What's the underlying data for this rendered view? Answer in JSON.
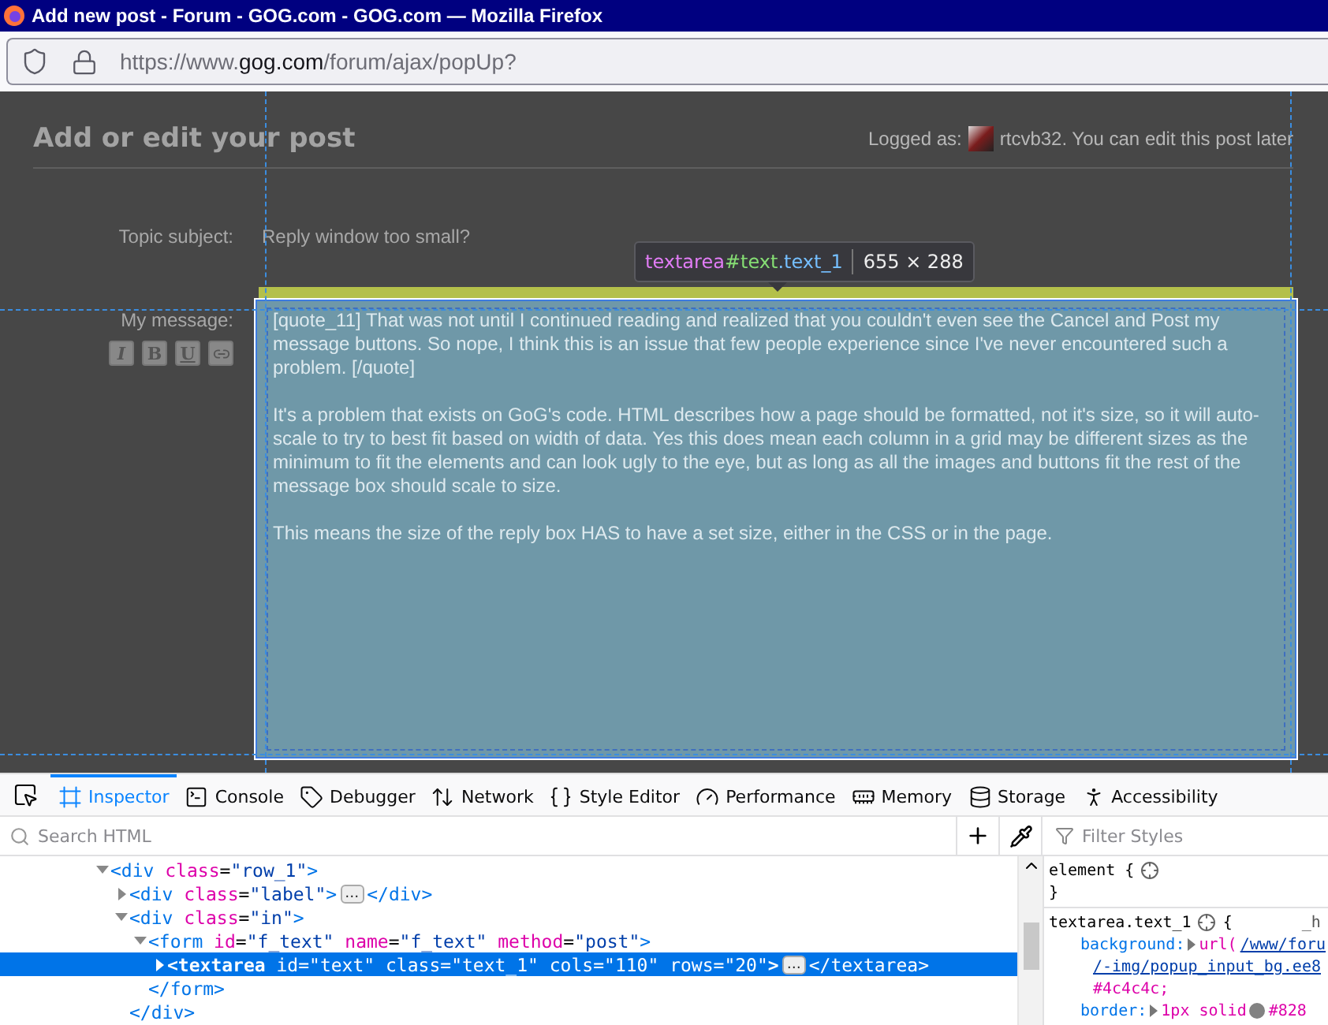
{
  "window": {
    "title": "Add new post - Forum - GOG.com - GOG.com — Mozilla Firefox"
  },
  "address_bar": {
    "url_prefix": "https://www.",
    "url_domain": "gog.com",
    "url_path": "/forum/ajax/popUp?"
  },
  "page": {
    "heading": "Add or edit your post",
    "logged_as": "Logged as:",
    "user_note": "rtcvb32. You can edit this post later",
    "topic_label": "Topic subject:",
    "topic_value": "Reply window too small?",
    "message_label": "My message:",
    "format_buttons": [
      {
        "kind": "italic",
        "label": "I"
      },
      {
        "kind": "bold",
        "label": "B"
      },
      {
        "kind": "underline",
        "label": "U"
      },
      {
        "kind": "link"
      }
    ],
    "message_paragraphs": [
      "[quote_11] That was not until I continued reading and realized that you couldn't even see the Cancel and Post my message buttons. So nope, I think this is an issue that few people experience since I've never encountered such a problem.  [/quote]",
      "It's a problem that exists on GoG's code. HTML describes how a page should be formatted, not it's size, so it will auto-scale to try to best fit based on width of data. Yes this does mean each column in a grid may be different sizes as the minimum to fit the elements and can look ugly to the eye, but as long as all the images and buttons fit the rest of the message box should scale to size.",
      "This means the size of the reply box HAS to have a set size, either in the CSS or in the page."
    ],
    "tooltip": {
      "tag": "textarea",
      "id": "#text",
      "cls": ".text_1",
      "size": "655 × 288"
    }
  },
  "devtools": {
    "tabs": [
      {
        "kind": "inspector",
        "label": "Inspector",
        "selected": true
      },
      {
        "kind": "console",
        "label": "Console",
        "selected": false
      },
      {
        "kind": "debugger",
        "label": "Debugger",
        "selected": false
      },
      {
        "kind": "network",
        "label": "Network",
        "selected": false
      },
      {
        "kind": "style",
        "label": "Style Editor",
        "selected": false
      },
      {
        "kind": "performance",
        "label": "Performance",
        "selected": false
      },
      {
        "kind": "memory",
        "label": "Memory",
        "selected": false
      },
      {
        "kind": "storage",
        "label": "Storage",
        "selected": false
      },
      {
        "kind": "accessibility",
        "label": "Accessibility",
        "selected": false
      }
    ],
    "search_placeholder": "Search HTML",
    "filter_placeholder": "Filter Styles",
    "markup": [
      {
        "expanded": true,
        "selected": false,
        "tokens": [
          {
            "kind": "tag",
            "t": "<div"
          },
          {
            "kind": "attr",
            "t": " class"
          },
          {
            "kind": "punct",
            "t": "="
          },
          {
            "kind": "val",
            "t": "\"row_1\""
          },
          {
            "kind": "tag",
            "t": ">"
          }
        ],
        "children": [
          {
            "expanded": false,
            "selected": false,
            "tokens": [
              {
                "kind": "tag",
                "t": "<div"
              },
              {
                "kind": "attr",
                "t": " class"
              },
              {
                "kind": "punct",
                "t": "="
              },
              {
                "kind": "val",
                "t": "\"label\""
              },
              {
                "kind": "tag",
                "t": ">"
              }
            ],
            "badge": "…",
            "close": "</div>"
          },
          {
            "expanded": true,
            "selected": false,
            "tokens": [
              {
                "kind": "tag",
                "t": "<div"
              },
              {
                "kind": "attr",
                "t": " class"
              },
              {
                "kind": "punct",
                "t": "="
              },
              {
                "kind": "val",
                "t": "\"in\""
              },
              {
                "kind": "tag",
                "t": ">"
              }
            ],
            "end": "</div>",
            "children": [
              {
                "expanded": true,
                "selected": false,
                "tokens": [
                  {
                    "kind": "tag",
                    "t": "<form"
                  },
                  {
                    "kind": "attr",
                    "t": " id"
                  },
                  {
                    "kind": "punct",
                    "t": "="
                  },
                  {
                    "kind": "val",
                    "t": "\"f_text\""
                  },
                  {
                    "kind": "attr",
                    "t": " name"
                  },
                  {
                    "kind": "punct",
                    "t": "="
                  },
                  {
                    "kind": "val",
                    "t": "\"f_text\""
                  },
                  {
                    "kind": "attr",
                    "t": " method"
                  },
                  {
                    "kind": "punct",
                    "t": "="
                  },
                  {
                    "kind": "val",
                    "t": "\"post\""
                  },
                  {
                    "kind": "tag",
                    "t": ">"
                  }
                ],
                "end": "</form>",
                "children": [
                  {
                    "expanded": false,
                    "selected": true,
                    "tokens": [
                      {
                        "kind": "tag",
                        "t": "<textarea"
                      },
                      {
                        "kind": "attr",
                        "t": " id"
                      },
                      {
                        "kind": "punct",
                        "t": "="
                      },
                      {
                        "kind": "val",
                        "t": "\"text\""
                      },
                      {
                        "kind": "attr",
                        "t": " class"
                      },
                      {
                        "kind": "punct",
                        "t": "="
                      },
                      {
                        "kind": "val",
                        "t": "\"text_1\""
                      },
                      {
                        "kind": "attr",
                        "t": " cols"
                      },
                      {
                        "kind": "punct",
                        "t": "="
                      },
                      {
                        "kind": "val",
                        "t": "\"110\""
                      },
                      {
                        "kind": "attr",
                        "t": " rows"
                      },
                      {
                        "kind": "punct",
                        "t": "="
                      },
                      {
                        "kind": "val",
                        "t": "\"20\""
                      },
                      {
                        "kind": "tag",
                        "t": ">"
                      }
                    ],
                    "badge": "…",
                    "close": "</textarea>"
                  }
                ]
              }
            ]
          }
        ]
      }
    ],
    "rules": [
      {
        "selector": "element {",
        "close": "}"
      },
      {
        "selector": "textarea.text_1",
        "open": "{",
        "source": "_h",
        "props": [
          {
            "name": "background:",
            "value_parts": [
              {
                "kind": "fn",
                "t": "url("
              },
              {
                "kind": "link",
                "t": "/www/foru"
              }
            ],
            "cont": [
              {
                "kind": "link",
                "t": "/-img/popup_input_bg.ee8"
              },
              {
                "kind": "val",
                "t": "#4c4c4c;"
              }
            ]
          },
          {
            "name": "border:",
            "value_parts": [
              {
                "kind": "val",
                "t": "1px solid"
              },
              {
                "kind": "swatch",
                "color": "#828282"
              },
              {
                "kind": "val",
                "t": "#828"
              }
            ]
          }
        ]
      }
    ]
  }
}
